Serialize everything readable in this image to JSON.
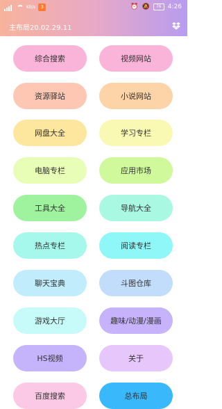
{
  "status": {
    "network_label": "KB/s",
    "badge": "3",
    "battery": "76",
    "time": "4:26"
  },
  "app": {
    "title": "主布局20.02.29.11",
    "icon": "dropbox-icon"
  },
  "buttons": [
    {
      "label": "综合搜索",
      "color": "#fbb4d9"
    },
    {
      "label": "视频网站",
      "color": "#fbb4d9"
    },
    {
      "label": "资源驿站",
      "color": "#fdc7b3"
    },
    {
      "label": "小说网站",
      "color": "#fdd3a8"
    },
    {
      "label": "网盘大全",
      "color": "#fde79e"
    },
    {
      "label": "学习专栏",
      "color": "#f9f9b3"
    },
    {
      "label": "电脑专栏",
      "color": "#e8fdb5"
    },
    {
      "label": "应用市场",
      "color": "#cff99a"
    },
    {
      "label": "工具大全",
      "color": "#9ff39f"
    },
    {
      "label": "导航大全",
      "color": "#a9f8e1"
    },
    {
      "label": "热点专栏",
      "color": "#a7f8ec"
    },
    {
      "label": "阅读专栏",
      "color": "#8ff7f7"
    },
    {
      "label": "聊天宝典",
      "color": "#c1ecfb"
    },
    {
      "label": "斗图仓库",
      "color": "#c2dcfb"
    },
    {
      "label": "游戏大厅",
      "color": "#c6fbf9"
    },
    {
      "label": "趣味/动漫/漫画",
      "color": "#c6b3fb"
    },
    {
      "label": "HS视频",
      "color": "#c5b3fb"
    },
    {
      "label": "关于",
      "color": "#e7c7fb"
    },
    {
      "label": "百度搜索",
      "color": "#fbc8e6"
    },
    {
      "label": "总布局",
      "color": "#39b8fb"
    }
  ]
}
